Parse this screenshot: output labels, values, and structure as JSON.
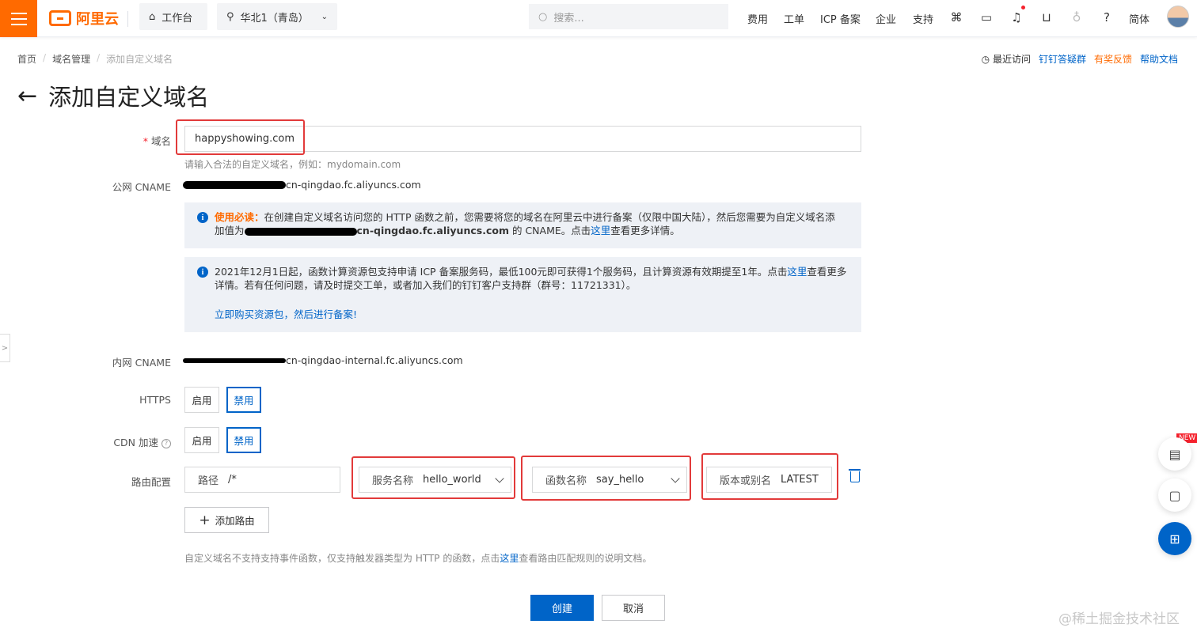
{
  "header": {
    "logo_text": "阿里云",
    "workbench": "工作台",
    "region": "华北1（青岛）",
    "search_placeholder": "搜索...",
    "nav": [
      "费用",
      "工单",
      "ICP 备案",
      "企业",
      "支持"
    ],
    "lang": "简体"
  },
  "breadcrumb": [
    "首页",
    "域名管理",
    "添加自定义域名"
  ],
  "help_links": {
    "recent": "最近访问",
    "dingtalk": "钉钉答疑群",
    "feedback": "有奖反馈",
    "docs": "帮助文档"
  },
  "page_title": "添加自定义域名",
  "form": {
    "domain_label": "域名",
    "domain_value": "happyshowing.com",
    "domain_hint": "请输入合法的自定义域名，例如：mydomain.com",
    "public_cname_label": "公网 CNAME",
    "public_cname_suffix": "cn-qingdao.fc.aliyuncs.com",
    "notice1_prefix": "使用必读：",
    "notice1_text1": "在创建自定义域名访问您的 HTTP 函数之前，您需要将您的域名在阿里云中进行备案（仅限中国大陆），然后您需要为自定义域名添",
    "notice1_text2_prefix": "加值为",
    "notice1_cname": "cn-qingdao.fc.aliyuncs.com",
    "notice1_text2_suffix": "的 CNAME。点击",
    "notice1_link": "这里",
    "notice1_text2_end": "查看更多详情。",
    "notice2_text1": "2021年12月1日起，函数计算资源包支持申请 ICP 备案服务码，最低100元即可获得1个服务码，且计算资源有效期提至1年。点击",
    "notice2_link": "这里",
    "notice2_text1_end": "查看更多",
    "notice2_text2": "详情。若有任何问题，请及时提交工单，或者加入我们的钉钉客户支持群（群号：11721331）。",
    "notice2_action": "立即购买资源包，然后进行备案!",
    "internal_cname_label": "内网 CNAME",
    "internal_cname_suffix": "cn-qingdao-internal.fc.aliyuncs.com",
    "https_label": "HTTPS",
    "cdn_label": "CDN 加速",
    "enable": "启用",
    "disable": "禁用",
    "route_label": "路由配置",
    "path_key": "路径",
    "path_value": "/*",
    "service_key": "服务名称",
    "service_value": "hello_world",
    "function_key": "函数名称",
    "function_value": "say_hello",
    "version_key": "版本或别名",
    "version_value": "LATEST",
    "add_route": "添加路由",
    "route_note_prefix": "自定义域名不支持支持事件函数，仅支持触发器类型为 HTTP 的函数，点击",
    "route_note_link": "这里",
    "route_note_suffix": "查看路由匹配规则的说明文档。"
  },
  "actions": {
    "create": "创建",
    "cancel": "取消"
  },
  "float_new_badge": "NEW",
  "watermark": "@稀土掘金技术社区",
  "colors": {
    "brand": "#ff6a00",
    "primary": "#0064c8",
    "highlight": "#e23a3a"
  }
}
